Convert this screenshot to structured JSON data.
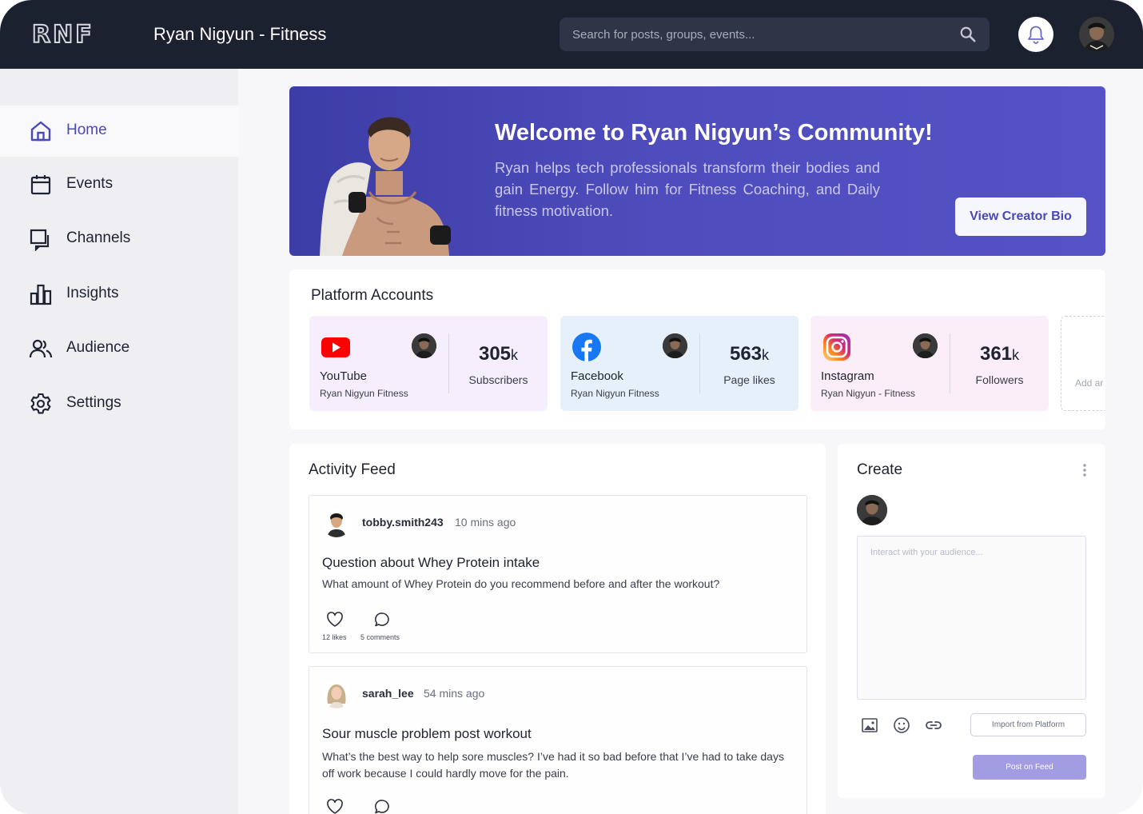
{
  "header": {
    "logo": "RNF",
    "title": "Ryan Nigyun - Fitness",
    "search_placeholder": "Search for posts, groups, events..."
  },
  "sidebar": {
    "items": [
      {
        "label": "Home",
        "icon": "home-icon",
        "active": true
      },
      {
        "label": "Events",
        "icon": "calendar-icon"
      },
      {
        "label": "Channels",
        "icon": "channels-icon"
      },
      {
        "label": "Insights",
        "icon": "bar-chart-icon"
      },
      {
        "label": "Audience",
        "icon": "users-icon"
      },
      {
        "label": "Settings",
        "icon": "gear-icon"
      }
    ]
  },
  "hero": {
    "title": "Welcome to Ryan Nigyun’s Community!",
    "description": "Ryan helps tech professionals transform their bodies and gain Energy. Follow him for Fitness Coaching, and Daily fitness motivation.",
    "button": "View Creator Bio"
  },
  "platforms": {
    "title": "Platform Accounts",
    "accounts": [
      {
        "platform": "YouTube",
        "account": "Ryan Nigyun Fitness",
        "count": "305",
        "unit": "k",
        "metric": "Subscribers",
        "color": "#f6eefc",
        "icon": "youtube-icon"
      },
      {
        "platform": "Facebook",
        "account": "Ryan Nigyun Fitness",
        "count": "563",
        "unit": "k",
        "metric": "Page likes",
        "color": "#e6f0fb",
        "icon": "facebook-icon"
      },
      {
        "platform": "Instagram",
        "account": "Ryan Nigyun - Fitness",
        "count": "361",
        "unit": "k",
        "metric": "Followers",
        "color": "#fceef8",
        "icon": "instagram-icon"
      }
    ],
    "add_label": "Add ar"
  },
  "feed": {
    "title": "Activity Feed",
    "posts": [
      {
        "user": "tobby.smith243",
        "time": "10 mins ago",
        "title": "Question about Whey Protein intake",
        "body": "What amount of Whey Protein do you recommend before and after the workout?",
        "likes": "12 likes",
        "comments": "5 comments"
      },
      {
        "user": "sarah_lee",
        "time": "54 mins ago",
        "title": "Sour muscle problem post workout",
        "body": "What’s the best way to help sore muscles? I’ve had it so bad before that I’ve had to take days off work because I could hardly move for the pain."
      }
    ]
  },
  "create": {
    "title": "Create",
    "placeholder": "Interact with your audience...",
    "import_button": "Import from Platform",
    "post_button": "Post on Feed"
  },
  "colors": {
    "topbar": "#1c2130",
    "accent": "#4a47b8",
    "hero_start": "#3d3da6",
    "hero_end": "#5552c6",
    "post_button": "#a29ce3"
  }
}
